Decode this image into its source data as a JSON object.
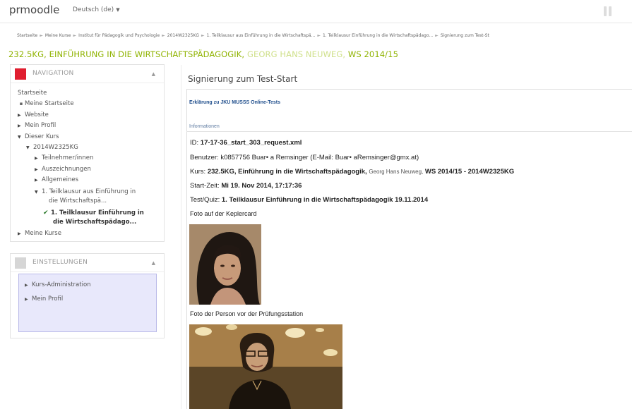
{
  "topbar": {
    "brand": "prmoodle",
    "language": "Deutsch (de)",
    "language_caret": "▼"
  },
  "breadcrumb": [
    "Startseite",
    "Meine Kurse",
    "Institut für Pädagogik und Psychologie",
    "2014W2325KG",
    "1. Teilklausur aus Einführung in die Wirtschaftspä...",
    "1. Teilklausur Einführung in die Wirtschaftspädago...",
    "Signierung zum Test-St"
  ],
  "breadcrumb_separator": "►",
  "course": {
    "title_main": "232.5KG, EINFÜHRUNG IN DIE WIRTSCHAFTSPÄDAGOGIK,",
    "title_faint": "GEORG HANS NEUWEG,",
    "title_tail": "WS 2014/15"
  },
  "navigation": {
    "title": "NAVIGATION",
    "items": {
      "startseite": "Startseite",
      "meine_startseite": "Meine Startseite",
      "website": "Website",
      "mein_profil": "Mein Profil",
      "dieser_kurs": "Dieser Kurs",
      "course_code": "2014W2325KG",
      "teilnehmer": "Teilnehmer/innen",
      "auszeichnungen": "Auszeichnungen",
      "allgemeines": "Allgemeines",
      "section1_line1": "1. Teilklausur aus Einführung in",
      "section1_line2": "die Wirtschaftspä...",
      "active_line1": "1. Teilklausur Einführung in",
      "active_line2": "die Wirtschaftspädago...",
      "meine_kurse": "Meine Kurse"
    }
  },
  "settings": {
    "title": "EINSTELLUNGEN",
    "items": {
      "kurs_admin": "Kurs-Administration",
      "mein_profil": "Mein Profil"
    }
  },
  "main": {
    "title": "Signierung zum Test-Start",
    "jku_link": "Erklärung zu JKU MUSSS Online-Tests",
    "info_heading": "Informationen",
    "id_label": "ID:",
    "id_value": "17-17-36_start_303_request.xml",
    "benutzer_label": "Benutzer:",
    "benutzer_value": "k0857756  Buar• a Remsinger (E-Mail: Buar• aRemsinger@gmx.at)",
    "kurs_label": "Kurs:",
    "kurs_value": "232.5KG, Einführung in die Wirtschaftspädagogik,",
    "kurs_value_dim": "Georg Hans Neuweg,",
    "kurs_value_tail": "WS 2014/15 - 2014W2325KG",
    "start_label": "Start-Zeit:",
    "start_value": "Mi 19. Nov 2014, 17:17:36",
    "quiz_label": "Test/Quiz:",
    "quiz_value": "1. Teilklausur Einführung in die Wirtschaftspädagogik 19.11.2014",
    "photo1_caption": "Foto auf der Keplercard",
    "photo2_caption": "Foto der Person vor der Prüfungsstation"
  }
}
